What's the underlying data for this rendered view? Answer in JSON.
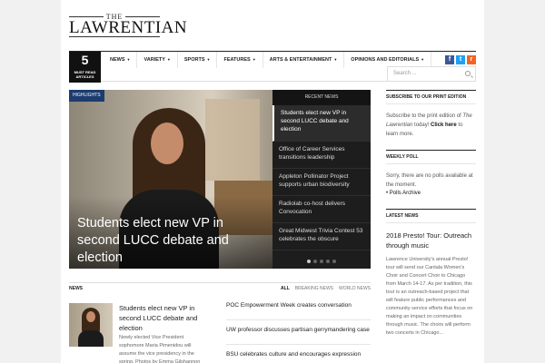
{
  "masthead": {
    "the": "THE",
    "name": "LAWRENTIAN"
  },
  "nav": {
    "must_read_count": "5",
    "must_read_label": "MUST READ ARTICLES",
    "items": [
      "NEWS",
      "VARIETY",
      "SPORTS",
      "FEATURES",
      "ARTS & ENTERTAINMENT",
      "OPINIONS AND EDITORIALS"
    ],
    "search_placeholder": "Search ...",
    "social": [
      "f",
      "t",
      "r"
    ]
  },
  "highlights": {
    "tag": "HIGHLIGHTS",
    "headline": "Students elect new VP in second LUCC debate and election"
  },
  "recent": {
    "title": "RECENT NEWS",
    "items": [
      "Students elect new VP in second LUCC debate and election",
      "Office of Career Services transitions leadership",
      "Appleton Pollinator Project supports urban biodiversity",
      "Radiolab co-host delivers Convocation",
      "Great Midwest Trivia Contest 53 celebrates the obscure"
    ],
    "dots": 5,
    "active_dot": 0
  },
  "news": {
    "title": "NEWS",
    "filters": [
      "ALL",
      "BREAKING NEWS",
      "WORLD NEWS"
    ],
    "lead_title": "Students elect new VP in second LUCC debate and election",
    "lead_desc": "Newly elected Vice President sophomore Maria Pimenidou will assume the vice presidency in the spring. Photos by Emma Gilshannon",
    "list": [
      "POC Empowerment Week creates conversation",
      "UW professor discusses partisan gerrymandering case",
      "BSU celebrates culture and encourages expression"
    ]
  },
  "sidebar": {
    "subscribe_title": "SUBSCRIBE TO OUR PRINT EDITION",
    "subscribe_text_1": "Subscribe to the print edition of ",
    "subscribe_italic": "The Lawrentian",
    "subscribe_text_2": " today! ",
    "subscribe_link": "Click here",
    "subscribe_text_3": " to learn more.",
    "poll_title": "WEEKLY POLL",
    "poll_text": "Sorry, there are no polls available at the moment.",
    "poll_archive": "Polls Archive",
    "latest_title": "LATEST NEWS",
    "latest_headline": "2018 Presto! Tour: Outreach through music",
    "latest_desc": "Lawrence University's annual Presto! tour will send our Cantala Women's Choir and Concert Choir to Chicago from March 14-17. As per tradition, this tour is an outreach-based project that will feature public performances and community service efforts that focus on making an impact on communities through music. The choirs will perform two concerts in Chicago..."
  }
}
